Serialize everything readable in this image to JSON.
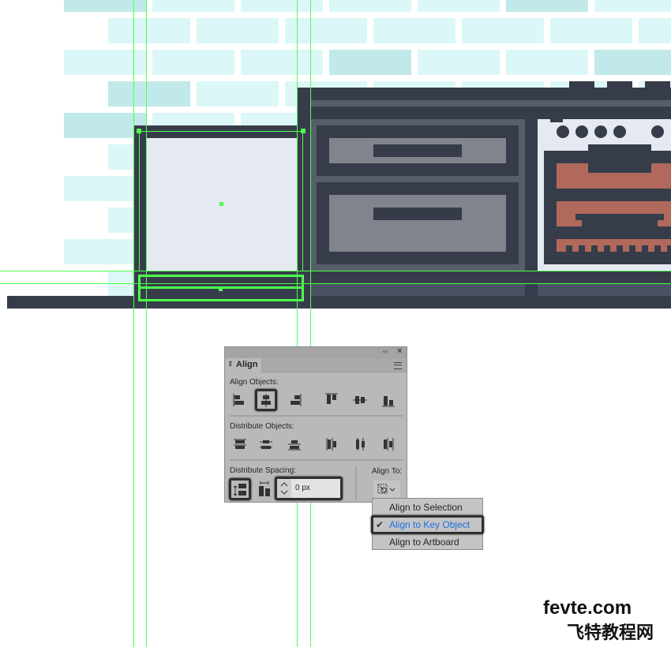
{
  "colors": {
    "wall_light": "#dcf7f7",
    "wall_dark": "#c1e9e9",
    "cabinet_dark": "#373c4a",
    "panel_mid": "#575e6b",
    "drawer_grey": "#81848c",
    "oven_white": "#e4e9f2",
    "oven_red": "#b0695b",
    "guide_green": "#4cff4c",
    "accent_blue": "#1a6fe0"
  },
  "panel": {
    "tab_label": "Align",
    "collapse_icon": "double-chevron-left-icon",
    "close_icon": "close-icon",
    "menu_icon": "hamburger-icon",
    "align_objects_label": "Align Objects:",
    "align_objects_buttons": [
      "horizontal-align-left",
      "horizontal-align-center",
      "horizontal-align-right",
      "vertical-align-top",
      "vertical-align-center",
      "vertical-align-bottom"
    ],
    "align_objects_selected": "horizontal-align-center",
    "distribute_objects_label": "Distribute Objects:",
    "distribute_objects_buttons": [
      "vertical-distribute-top",
      "vertical-distribute-center",
      "vertical-distribute-bottom",
      "horizontal-distribute-left",
      "horizontal-distribute-center",
      "horizontal-distribute-right"
    ],
    "distribute_spacing_label": "Distribute Spacing:",
    "distribute_spacing_buttons": [
      "vertical-distribute-space",
      "horizontal-distribute-space"
    ],
    "spacing_value": "0 px",
    "align_to_label": "Align To:",
    "align_to_icon": "align-to-key-object-icon"
  },
  "align_to_menu": {
    "items": [
      {
        "label": "Align to Selection",
        "checked": false
      },
      {
        "label": "Align to Key Object",
        "checked": true
      },
      {
        "label": "Align to Artboard",
        "checked": false
      }
    ]
  },
  "watermark": {
    "line1": "fevte.com",
    "line2": "飞特教程网"
  }
}
